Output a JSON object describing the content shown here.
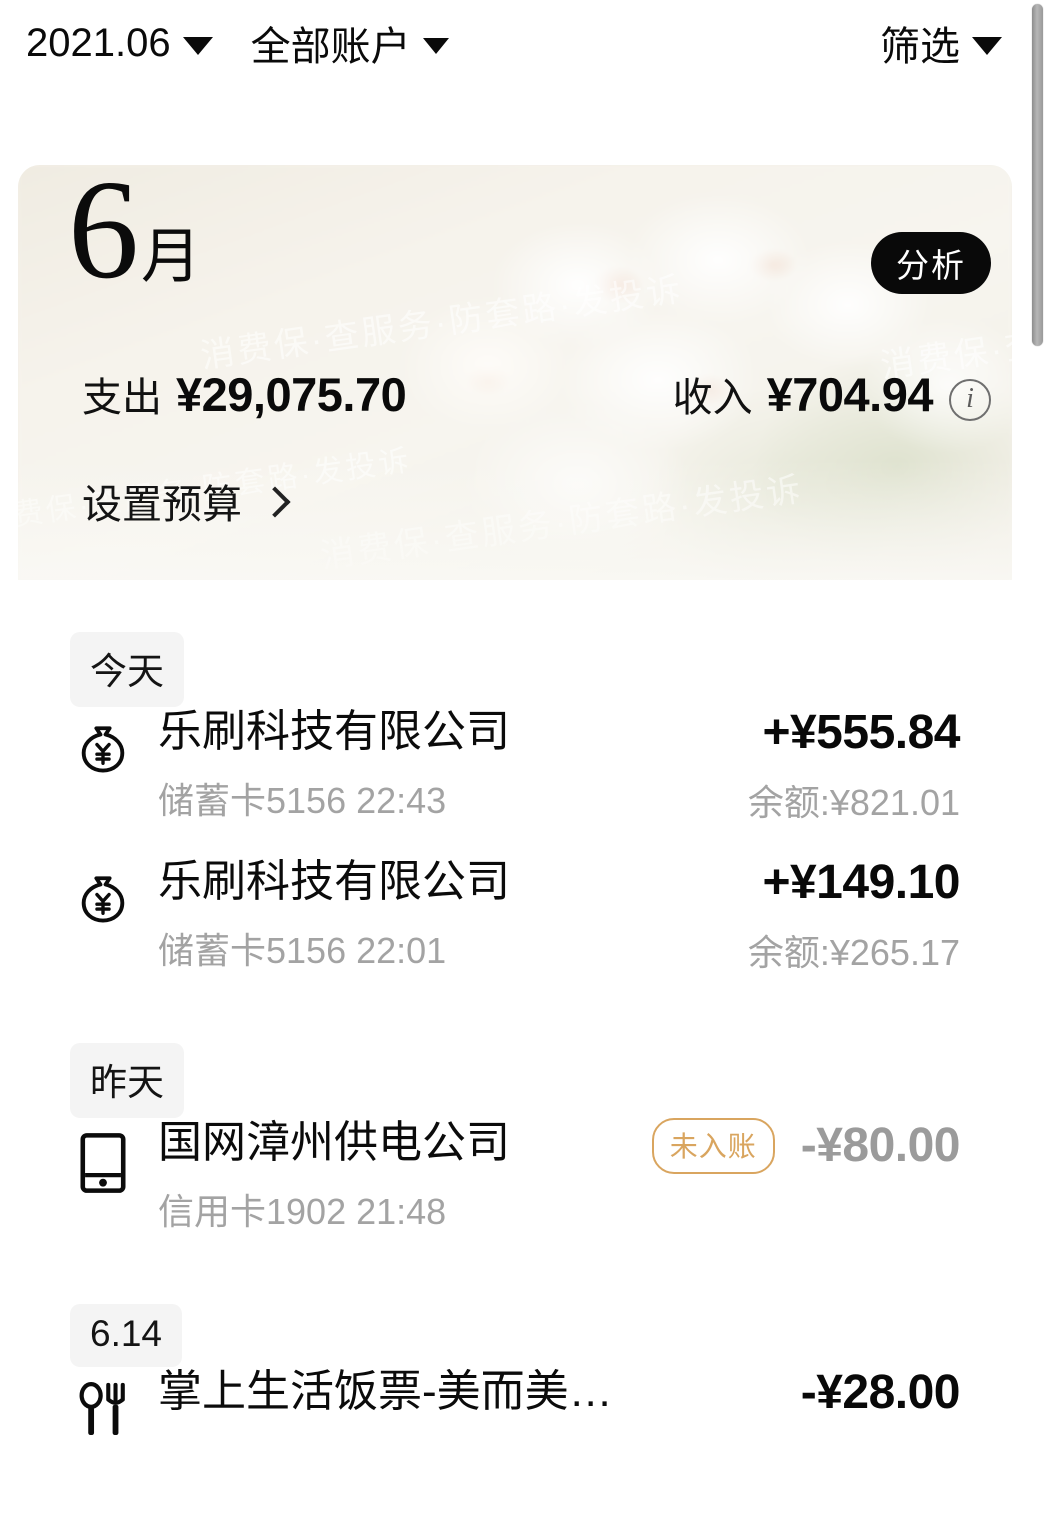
{
  "topbar": {
    "month_filter": "2021.06",
    "account_filter": "全部账户",
    "sort_filter": "筛选"
  },
  "summary_card": {
    "month_number": "6",
    "month_unit": "月",
    "analyze_label": "分析",
    "expense_label": "支出",
    "expense_value": "¥29,075.70",
    "income_label": "收入",
    "income_value": "¥704.94",
    "budget_label": "设置预算",
    "watermark": "消费保·查服务·防套路·发投诉"
  },
  "colors": {
    "pending_badge": "#d9a55f",
    "muted_text": "#a3a3a3",
    "primary_text": "#0b0b0b",
    "analyze_pill": "#090909",
    "chip_bg": "#f4f4f4"
  },
  "groups": [
    {
      "day_label": "今天",
      "transactions": [
        {
          "icon": "money-bag-icon",
          "title": "乐刷科技有限公司",
          "subtitle": "储蓄卡5156 22:43",
          "amount": "+¥555.84",
          "balance": "余额:¥821.01",
          "badge": "",
          "muted": false
        },
        {
          "icon": "money-bag-icon",
          "title": "乐刷科技有限公司",
          "subtitle": "储蓄卡5156 22:01",
          "amount": "+¥149.10",
          "balance": "余额:¥265.17",
          "badge": "",
          "muted": false
        }
      ]
    },
    {
      "day_label": "昨天",
      "transactions": [
        {
          "icon": "mobile-phone-icon",
          "title": "国网漳州供电公司",
          "subtitle": "信用卡1902 21:48",
          "amount": "-¥80.00",
          "balance": "",
          "badge": "未入账",
          "muted": true
        }
      ]
    },
    {
      "day_label": "6.14",
      "transactions": [
        {
          "icon": "cutlery-icon",
          "title": "掌上生活饭票-美而美…",
          "subtitle": "",
          "amount": "-¥28.00",
          "balance": "",
          "badge": "",
          "muted": false
        }
      ]
    }
  ]
}
